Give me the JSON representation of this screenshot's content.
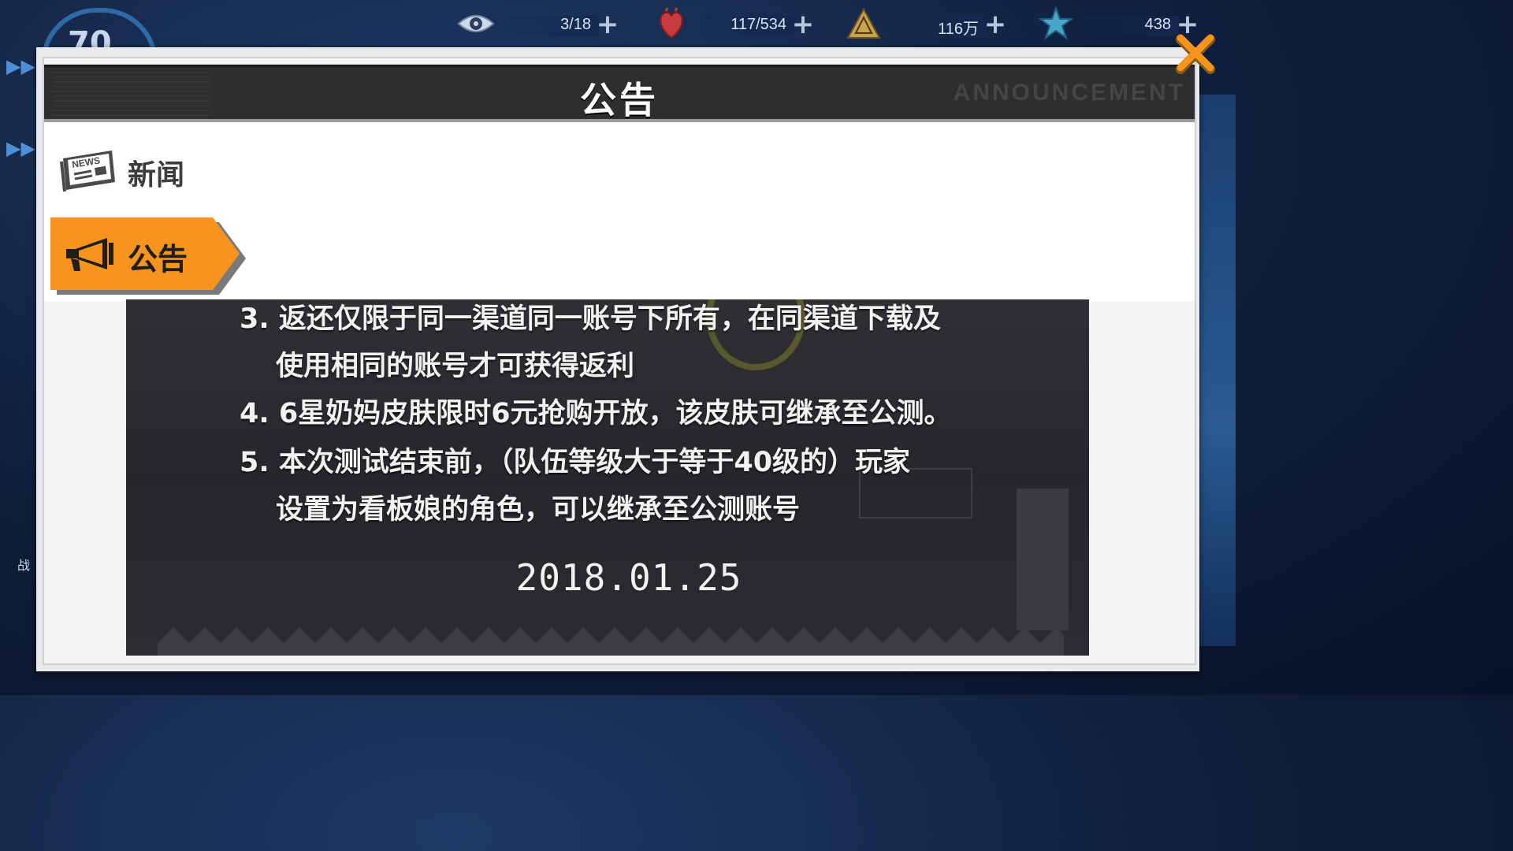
{
  "background": {
    "level_text": "70",
    "side_char": "战"
  },
  "resources": [
    {
      "icon": "eye-icon",
      "value": "3/18"
    },
    {
      "icon": "heart-icon",
      "value": "117/534"
    },
    {
      "icon": "warning-triangle-icon",
      "value": "116万"
    },
    {
      "icon": "star-crystal-icon",
      "value": "438"
    }
  ],
  "modal": {
    "title": "公告",
    "watermark": "ANNOUNCEMENT"
  },
  "tabs": [
    {
      "label": "新闻",
      "icon": "newspaper-icon",
      "active": false
    },
    {
      "label": "公告",
      "icon": "megaphone-icon",
      "active": true
    }
  ],
  "notice": {
    "lines": [
      "3. 返还仅限于同一渠道同一账号下所有，在同渠道下载及",
      "使用相同的账号才可获得返利",
      "4. 6星奶妈皮肤限时6元抢购开放，该皮肤可继承至公测。",
      "5. 本次测试结束前，（队伍等级大于等于40级的）玩家",
      "设置为看板娘的角色，可以继承至公测账号"
    ],
    "date": "2018.01.25"
  },
  "colors": {
    "accent": "#f7941d",
    "close": "#f7941d",
    "header_bg": "#2e2e30"
  }
}
